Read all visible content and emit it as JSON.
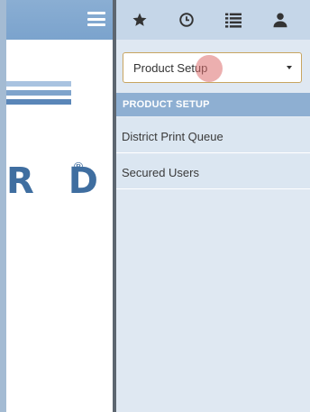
{
  "left_pane": {
    "logo": {
      "text": "R D",
      "registered_mark": "®",
      "bar_colors": [
        "#a9c3e0",
        "#7fa4cc",
        "#5a86b8",
        "#3f6ea0"
      ]
    },
    "menu_icon": "hamburger-menu-icon"
  },
  "toolbar": {
    "icons": [
      "star-icon",
      "clock-icon",
      "list-icon",
      "user-icon"
    ]
  },
  "product_select": {
    "value": "Product Setup"
  },
  "section": {
    "title": "PRODUCT SETUP"
  },
  "menu": {
    "items": [
      {
        "label": "District Print Queue"
      },
      {
        "label": "Secured Users"
      }
    ]
  },
  "colors": {
    "header_blue": "#7ba3cd",
    "panel_bg": "#dfe8f2",
    "section_header": "#8eafd2",
    "logo_blue": "#3f6ea0",
    "select_border": "#c8a560"
  }
}
